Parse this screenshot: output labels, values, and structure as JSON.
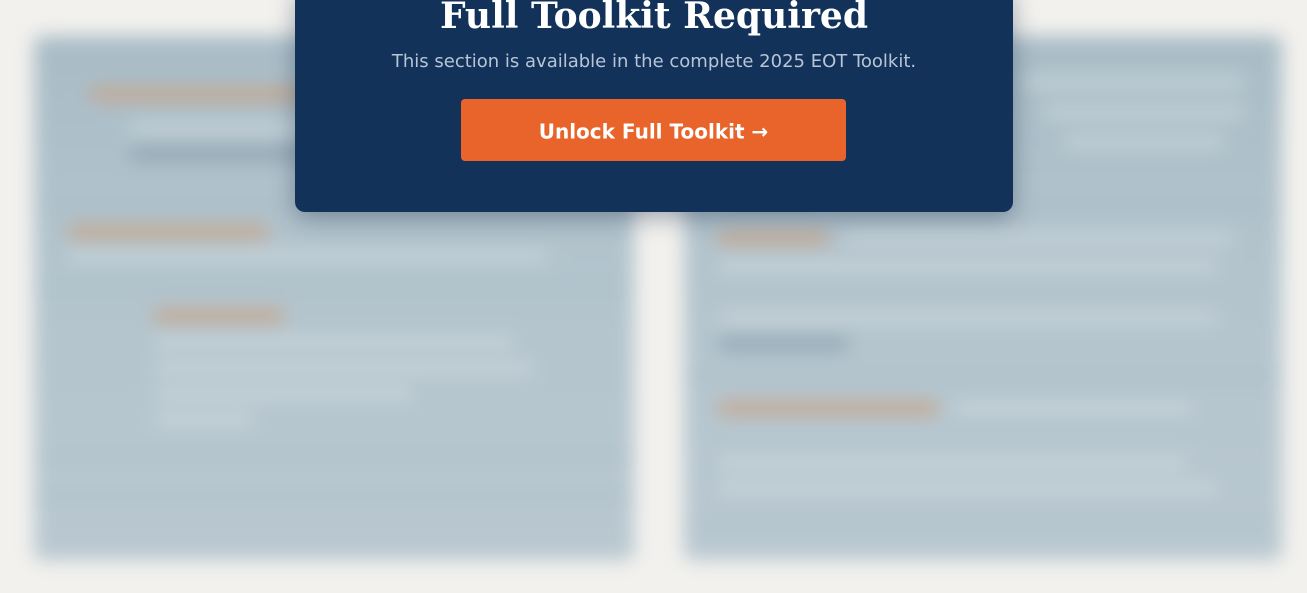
{
  "modal": {
    "title": "Full Toolkit Required",
    "subtitle": "This section is available in the complete 2025 EOT Toolkit.",
    "button_label": "Unlock Full Toolkit",
    "button_arrow": "→"
  },
  "colors": {
    "modal_background": "#13325a",
    "button_background": "#e8642a",
    "title_text": "#ffffff",
    "subtitle_text": "#b7c5d6",
    "page_background": "#f2f1ee",
    "blurred_panel": "#b3c4cd"
  }
}
